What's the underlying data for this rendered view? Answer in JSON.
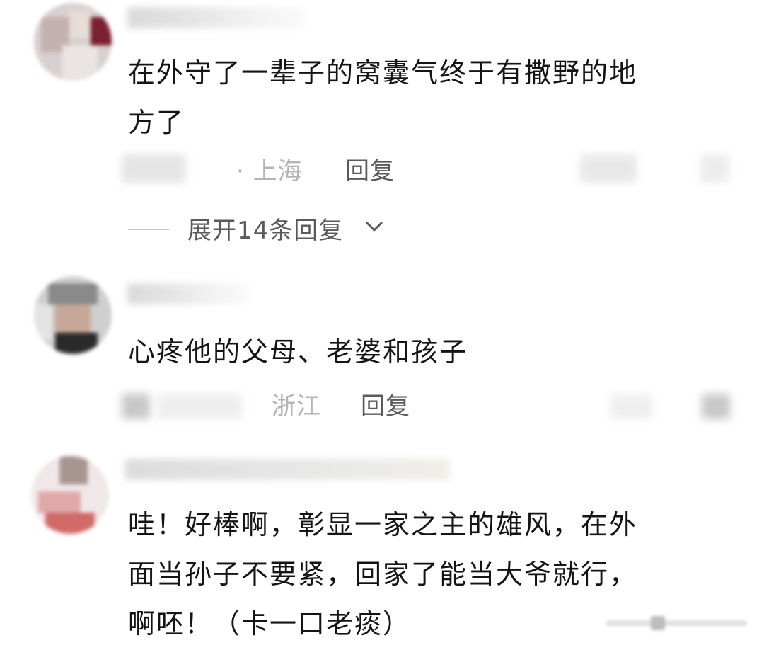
{
  "comments": [
    {
      "text": "在外守了一辈子的窝囊气终于有撒野的地\n方了",
      "location": "· 上海",
      "reply_label": "回复",
      "expand_replies_label": "展开14条回复"
    },
    {
      "text": "心疼他的父母、老婆和孩子",
      "location": "浙江",
      "reply_label": "回复"
    },
    {
      "text": "哇！好棒啊，彰显一家之主的雄风，在外\n面当孙子不要紧，回家了能当大爷就行，\n啊呸！（卡一口老痰）"
    }
  ],
  "icons": {
    "expand": "chevron-down-icon"
  },
  "colors": {
    "text": "#141414",
    "secondary": "#5a5a5a",
    "location": "#b4b4b4",
    "background": "#ffffff"
  }
}
